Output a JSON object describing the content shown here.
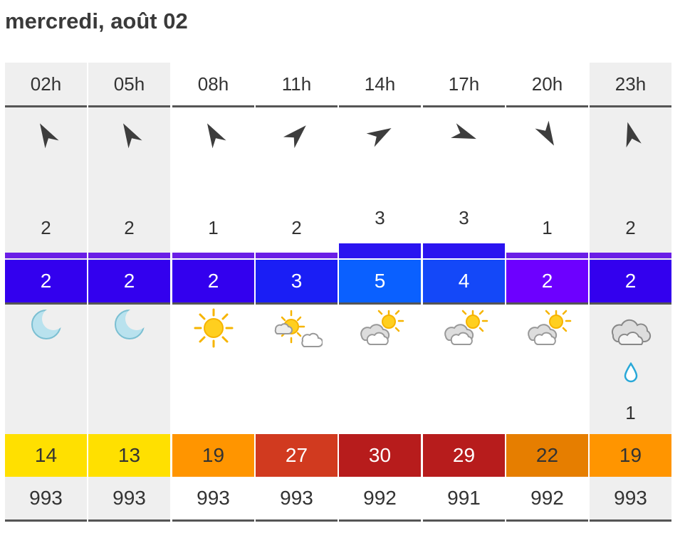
{
  "date_title": "mercredi, août 02",
  "columns": [
    {
      "hour": "02h",
      "night": true,
      "wind": "2",
      "wind_dir": 330,
      "wind_level": "low",
      "gust": "2",
      "gust_color": "#3300ee",
      "weather": "moon",
      "rain": "",
      "temp": "14",
      "temp_color": "#ffe000",
      "temp_text": "#333333",
      "pressure": "993"
    },
    {
      "hour": "05h",
      "night": true,
      "wind": "2",
      "wind_dir": 330,
      "wind_level": "low",
      "gust": "2",
      "gust_color": "#3300ee",
      "weather": "moon",
      "rain": "",
      "temp": "13",
      "temp_color": "#ffe000",
      "temp_text": "#333333",
      "pressure": "993"
    },
    {
      "hour": "08h",
      "night": false,
      "wind": "1",
      "wind_dir": 330,
      "wind_level": "low",
      "gust": "2",
      "gust_color": "#3300ee",
      "weather": "sun",
      "rain": "",
      "temp": "19",
      "temp_color": "#ff9500",
      "temp_text": "#333333",
      "pressure": "993"
    },
    {
      "hour": "11h",
      "night": false,
      "wind": "2",
      "wind_dir": 45,
      "wind_level": "low",
      "gust": "3",
      "gust_color": "#1a1ef5",
      "weather": "sun-cloud",
      "rain": "",
      "temp": "27",
      "temp_color": "#d13a1f",
      "temp_text": "#ffffff",
      "pressure": "993"
    },
    {
      "hour": "14h",
      "night": false,
      "wind": "3",
      "wind_dir": 60,
      "wind_level": "high",
      "gust": "5",
      "gust_color": "#0a60ff",
      "weather": "cloud-sun",
      "rain": "",
      "temp": "30",
      "temp_color": "#b71c1c",
      "temp_text": "#ffffff",
      "pressure": "992"
    },
    {
      "hour": "17h",
      "night": false,
      "wind": "3",
      "wind_dir": 110,
      "wind_level": "high",
      "gust": "4",
      "gust_color": "#1448f8",
      "weather": "cloud-sun",
      "rain": "",
      "temp": "29",
      "temp_color": "#b71c1c",
      "temp_text": "#ffffff",
      "pressure": "991"
    },
    {
      "hour": "20h",
      "night": false,
      "wind": "1",
      "wind_dir": 150,
      "wind_level": "low",
      "gust": "2",
      "gust_color": "#6d00ff",
      "weather": "cloud-sun",
      "rain": "",
      "temp": "22",
      "temp_color": "#e67e00",
      "temp_text": "#333333",
      "pressure": "992"
    },
    {
      "hour": "23h",
      "night": true,
      "wind": "2",
      "wind_dir": 345,
      "wind_level": "low",
      "gust": "2",
      "gust_color": "#3300ee",
      "weather": "cloud-rain",
      "rain": "1",
      "temp": "19",
      "temp_color": "#ff9500",
      "temp_text": "#333333",
      "pressure": "993"
    }
  ],
  "bar_colors": {
    "low": "#6a1ee6",
    "high": "#2a14f0"
  }
}
